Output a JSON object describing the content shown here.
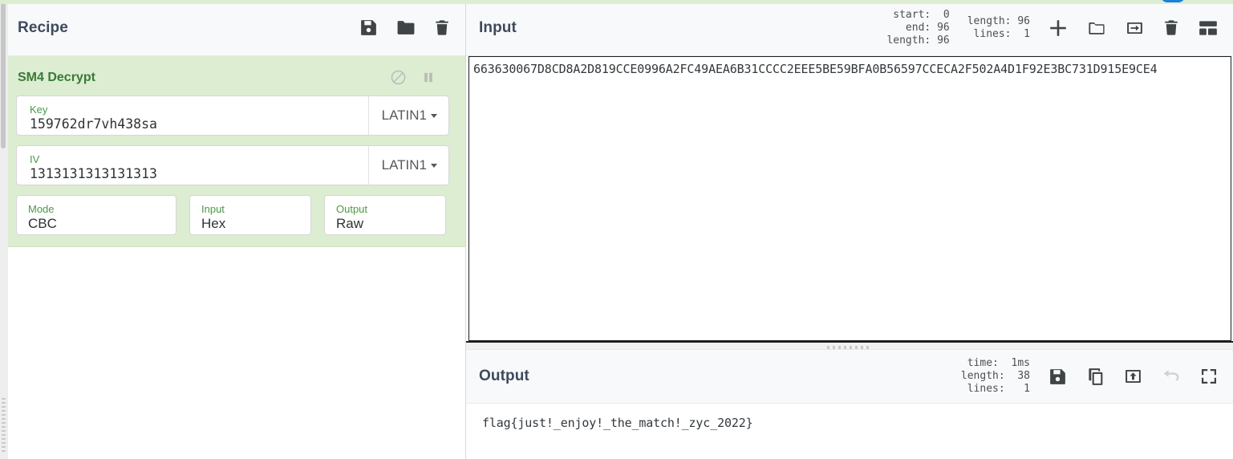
{
  "recipe": {
    "title": "Recipe",
    "icons": [
      {
        "name": "save-icon",
        "label": "Save recipe"
      },
      {
        "name": "folder-icon",
        "label": "Load recipe"
      },
      {
        "name": "trash-icon",
        "label": "Clear recipe"
      }
    ],
    "operation": {
      "title": "SM4 Decrypt",
      "disable_icon": "disable-icon",
      "pause_icon": "pause-icon",
      "args": [
        {
          "label": "Key",
          "value": "159762dr7vh438sa",
          "encoding": "LATIN1"
        },
        {
          "label": "IV",
          "value": "1313131313131313",
          "encoding": "LATIN1"
        }
      ],
      "selects": [
        {
          "label": "Mode",
          "value": "CBC"
        },
        {
          "label": "Input",
          "value": "Hex"
        },
        {
          "label": "Output",
          "value": "Raw"
        }
      ]
    }
  },
  "input": {
    "title": "Input",
    "selection": {
      "start_label": "start:",
      "start_value": "0",
      "end_label": "end:",
      "end_value": "96",
      "length_label": "length:",
      "length_value": "96"
    },
    "totals": {
      "length_label": "length:",
      "length_value": "96",
      "lines_label": "lines:",
      "lines_value": "1"
    },
    "value": "663630067D8CD8A2D819CCE0996A2FC49AEA6B31CCCC2EEE5BE59BFA0B56597CCECA2F502A4D1F92E3BC731D915E9CE4",
    "icons": [
      {
        "name": "add-tab-icon"
      },
      {
        "name": "folder-open-icon"
      },
      {
        "name": "import-icon"
      },
      {
        "name": "trash-icon"
      },
      {
        "name": "panel-layout-icon"
      }
    ]
  },
  "output": {
    "title": "Output",
    "stats": {
      "time_label": "time:",
      "time_value": "1ms",
      "length_label": "length:",
      "length_value": "38",
      "lines_label": "lines:",
      "lines_value": "1"
    },
    "value": "flag{just!_enjoy!_the_match!_zyc_2022}",
    "icons": [
      {
        "name": "save-icon"
      },
      {
        "name": "copy-icon"
      },
      {
        "name": "bake-to-input-icon"
      },
      {
        "name": "undo-icon"
      },
      {
        "name": "maximise-icon"
      }
    ]
  },
  "colors": {
    "operation_bg": "#dcedd2",
    "operation_title": "#3a7a35",
    "arg_label": "#4a9a45",
    "panel_title": "#3e4a5b"
  }
}
